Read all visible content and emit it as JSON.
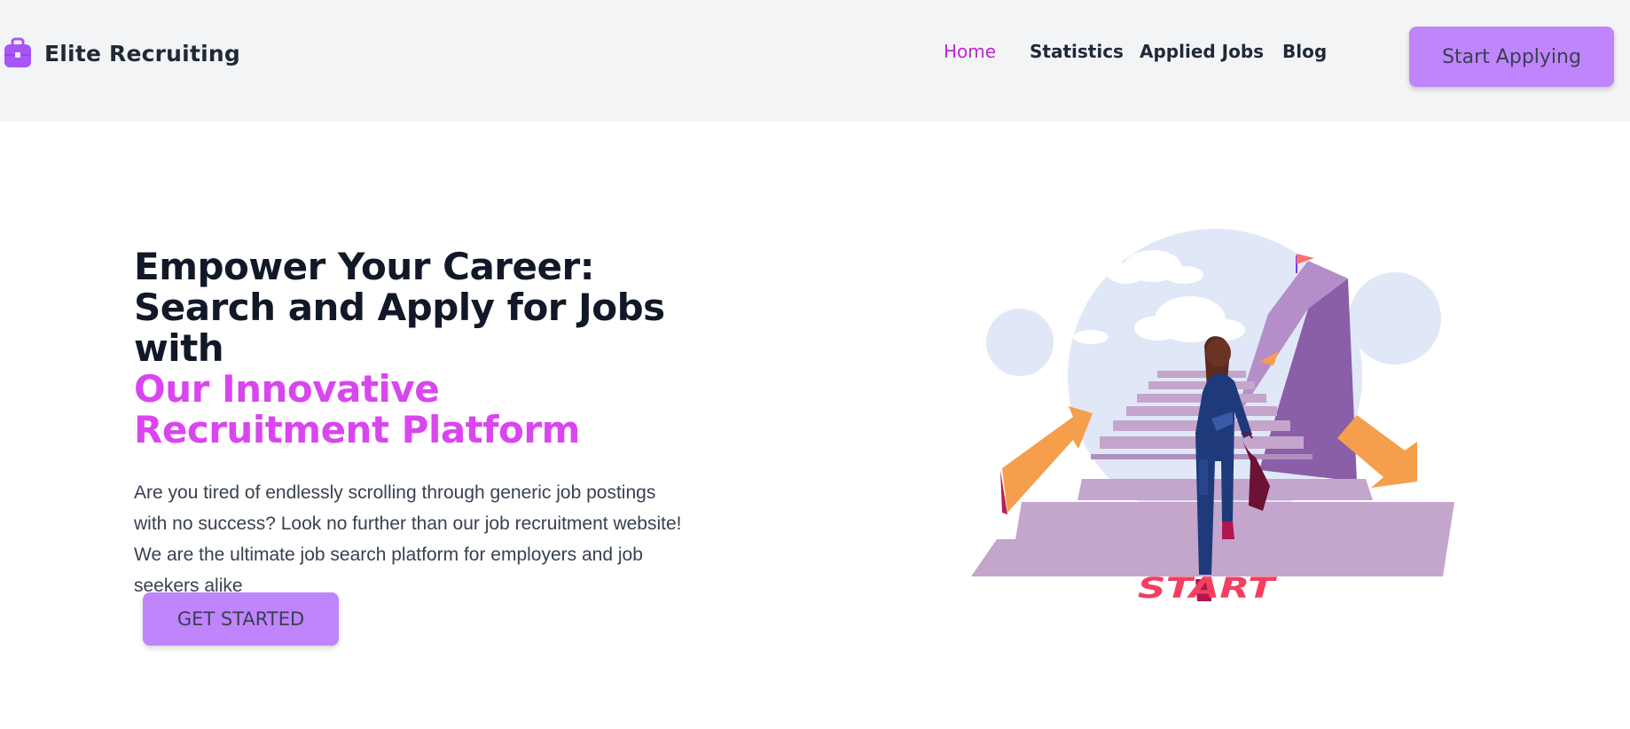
{
  "header": {
    "brand": {
      "name": "Elite Recruiting",
      "icon": "briefcase-icon"
    },
    "nav": [
      {
        "label": "Home",
        "active": true
      },
      {
        "label": "Statistics",
        "active": false
      },
      {
        "label": "Applied Jobs",
        "active": false
      },
      {
        "label": "Blog",
        "active": false
      }
    ],
    "cta_label": "Start Applying"
  },
  "hero": {
    "title_line1": "Empower Your Career: Search and Apply for Jobs with",
    "title_accent": "Our Innovative Recruitment Platform",
    "description": "Are you tired of endlessly scrolling through generic job postings with no success? Look no further than our job recruitment website! We are the ultimate job search platform for employers and job seekers alike",
    "cta_label": "GET STARTED",
    "illustration": {
      "icon": "woman-climbing-stairs-illustration",
      "ground_text": "START"
    }
  },
  "colors": {
    "accent_purple": "#c084fc",
    "accent_magenta": "#d946ef",
    "active_nav": "#c026d3",
    "header_bg": "#f3f4f6",
    "start_text": "#f43f5e"
  }
}
